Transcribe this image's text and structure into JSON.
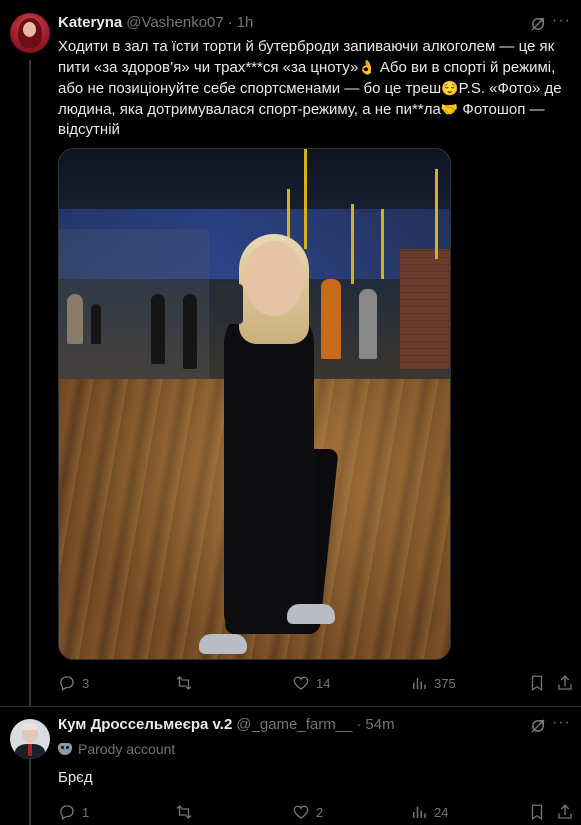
{
  "tweets": [
    {
      "author": {
        "name": "Kateryna",
        "handle": "@Vashenko07",
        "time": "1h"
      },
      "text_parts": {
        "p1": "Ходити в зал та їсти торти й бутерброди запиваючи алкоголем — це як пити «за здоров’я» чи трах***ся «за цноту»",
        "e1": "👌",
        "p2": " Або ви в спорті й режимі, або не позиціонуйте себе спортсменами — бо це треш",
        "e2": "😌",
        "p3": "P.S. «Фото» де людина, яка дотримувалася спорт-режиму, а не пи**ла",
        "e3": "🤝",
        "p4": " Фотошоп — відсутній"
      },
      "actions": {
        "replies": "3",
        "retweets": "",
        "likes": "14",
        "views": "375"
      }
    },
    {
      "author": {
        "name": "Кум Дроссельмеєра v.2",
        "handle": "@_game_farm__",
        "time": "54m"
      },
      "parody_label": "Parody account",
      "text": "Брєд",
      "actions": {
        "replies": "1",
        "retweets": "",
        "likes": "2",
        "views": "24"
      }
    }
  ],
  "dot": "·",
  "more": "···",
  "icons": {
    "reply": "reply-icon",
    "retweet": "retweet-icon",
    "like": "heart-icon",
    "views": "views-icon",
    "bookmark": "bookmark-icon",
    "share": "share-icon",
    "grok": "grok-icon",
    "parody": "mask-icon"
  },
  "colors": {
    "background": "#000000",
    "text": "#e7e9ea",
    "muted": "#71767b",
    "divider": "#2f3336"
  }
}
